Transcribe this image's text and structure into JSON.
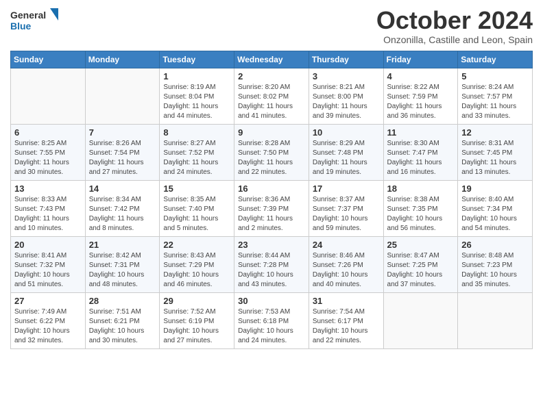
{
  "header": {
    "logo_general": "General",
    "logo_blue": "Blue",
    "month_title": "October 2024",
    "location": "Onzonilla, Castille and Leon, Spain"
  },
  "weekdays": [
    "Sunday",
    "Monday",
    "Tuesday",
    "Wednesday",
    "Thursday",
    "Friday",
    "Saturday"
  ],
  "weeks": [
    [
      {
        "day": "",
        "info": ""
      },
      {
        "day": "",
        "info": ""
      },
      {
        "day": "1",
        "info": "Sunrise: 8:19 AM\nSunset: 8:04 PM\nDaylight: 11 hours and 44 minutes."
      },
      {
        "day": "2",
        "info": "Sunrise: 8:20 AM\nSunset: 8:02 PM\nDaylight: 11 hours and 41 minutes."
      },
      {
        "day": "3",
        "info": "Sunrise: 8:21 AM\nSunset: 8:00 PM\nDaylight: 11 hours and 39 minutes."
      },
      {
        "day": "4",
        "info": "Sunrise: 8:22 AM\nSunset: 7:59 PM\nDaylight: 11 hours and 36 minutes."
      },
      {
        "day": "5",
        "info": "Sunrise: 8:24 AM\nSunset: 7:57 PM\nDaylight: 11 hours and 33 minutes."
      }
    ],
    [
      {
        "day": "6",
        "info": "Sunrise: 8:25 AM\nSunset: 7:55 PM\nDaylight: 11 hours and 30 minutes."
      },
      {
        "day": "7",
        "info": "Sunrise: 8:26 AM\nSunset: 7:54 PM\nDaylight: 11 hours and 27 minutes."
      },
      {
        "day": "8",
        "info": "Sunrise: 8:27 AM\nSunset: 7:52 PM\nDaylight: 11 hours and 24 minutes."
      },
      {
        "day": "9",
        "info": "Sunrise: 8:28 AM\nSunset: 7:50 PM\nDaylight: 11 hours and 22 minutes."
      },
      {
        "day": "10",
        "info": "Sunrise: 8:29 AM\nSunset: 7:48 PM\nDaylight: 11 hours and 19 minutes."
      },
      {
        "day": "11",
        "info": "Sunrise: 8:30 AM\nSunset: 7:47 PM\nDaylight: 11 hours and 16 minutes."
      },
      {
        "day": "12",
        "info": "Sunrise: 8:31 AM\nSunset: 7:45 PM\nDaylight: 11 hours and 13 minutes."
      }
    ],
    [
      {
        "day": "13",
        "info": "Sunrise: 8:33 AM\nSunset: 7:43 PM\nDaylight: 11 hours and 10 minutes."
      },
      {
        "day": "14",
        "info": "Sunrise: 8:34 AM\nSunset: 7:42 PM\nDaylight: 11 hours and 8 minutes."
      },
      {
        "day": "15",
        "info": "Sunrise: 8:35 AM\nSunset: 7:40 PM\nDaylight: 11 hours and 5 minutes."
      },
      {
        "day": "16",
        "info": "Sunrise: 8:36 AM\nSunset: 7:39 PM\nDaylight: 11 hours and 2 minutes."
      },
      {
        "day": "17",
        "info": "Sunrise: 8:37 AM\nSunset: 7:37 PM\nDaylight: 10 hours and 59 minutes."
      },
      {
        "day": "18",
        "info": "Sunrise: 8:38 AM\nSunset: 7:35 PM\nDaylight: 10 hours and 56 minutes."
      },
      {
        "day": "19",
        "info": "Sunrise: 8:40 AM\nSunset: 7:34 PM\nDaylight: 10 hours and 54 minutes."
      }
    ],
    [
      {
        "day": "20",
        "info": "Sunrise: 8:41 AM\nSunset: 7:32 PM\nDaylight: 10 hours and 51 minutes."
      },
      {
        "day": "21",
        "info": "Sunrise: 8:42 AM\nSunset: 7:31 PM\nDaylight: 10 hours and 48 minutes."
      },
      {
        "day": "22",
        "info": "Sunrise: 8:43 AM\nSunset: 7:29 PM\nDaylight: 10 hours and 46 minutes."
      },
      {
        "day": "23",
        "info": "Sunrise: 8:44 AM\nSunset: 7:28 PM\nDaylight: 10 hours and 43 minutes."
      },
      {
        "day": "24",
        "info": "Sunrise: 8:46 AM\nSunset: 7:26 PM\nDaylight: 10 hours and 40 minutes."
      },
      {
        "day": "25",
        "info": "Sunrise: 8:47 AM\nSunset: 7:25 PM\nDaylight: 10 hours and 37 minutes."
      },
      {
        "day": "26",
        "info": "Sunrise: 8:48 AM\nSunset: 7:23 PM\nDaylight: 10 hours and 35 minutes."
      }
    ],
    [
      {
        "day": "27",
        "info": "Sunrise: 7:49 AM\nSunset: 6:22 PM\nDaylight: 10 hours and 32 minutes."
      },
      {
        "day": "28",
        "info": "Sunrise: 7:51 AM\nSunset: 6:21 PM\nDaylight: 10 hours and 30 minutes."
      },
      {
        "day": "29",
        "info": "Sunrise: 7:52 AM\nSunset: 6:19 PM\nDaylight: 10 hours and 27 minutes."
      },
      {
        "day": "30",
        "info": "Sunrise: 7:53 AM\nSunset: 6:18 PM\nDaylight: 10 hours and 24 minutes."
      },
      {
        "day": "31",
        "info": "Sunrise: 7:54 AM\nSunset: 6:17 PM\nDaylight: 10 hours and 22 minutes."
      },
      {
        "day": "",
        "info": ""
      },
      {
        "day": "",
        "info": ""
      }
    ]
  ]
}
